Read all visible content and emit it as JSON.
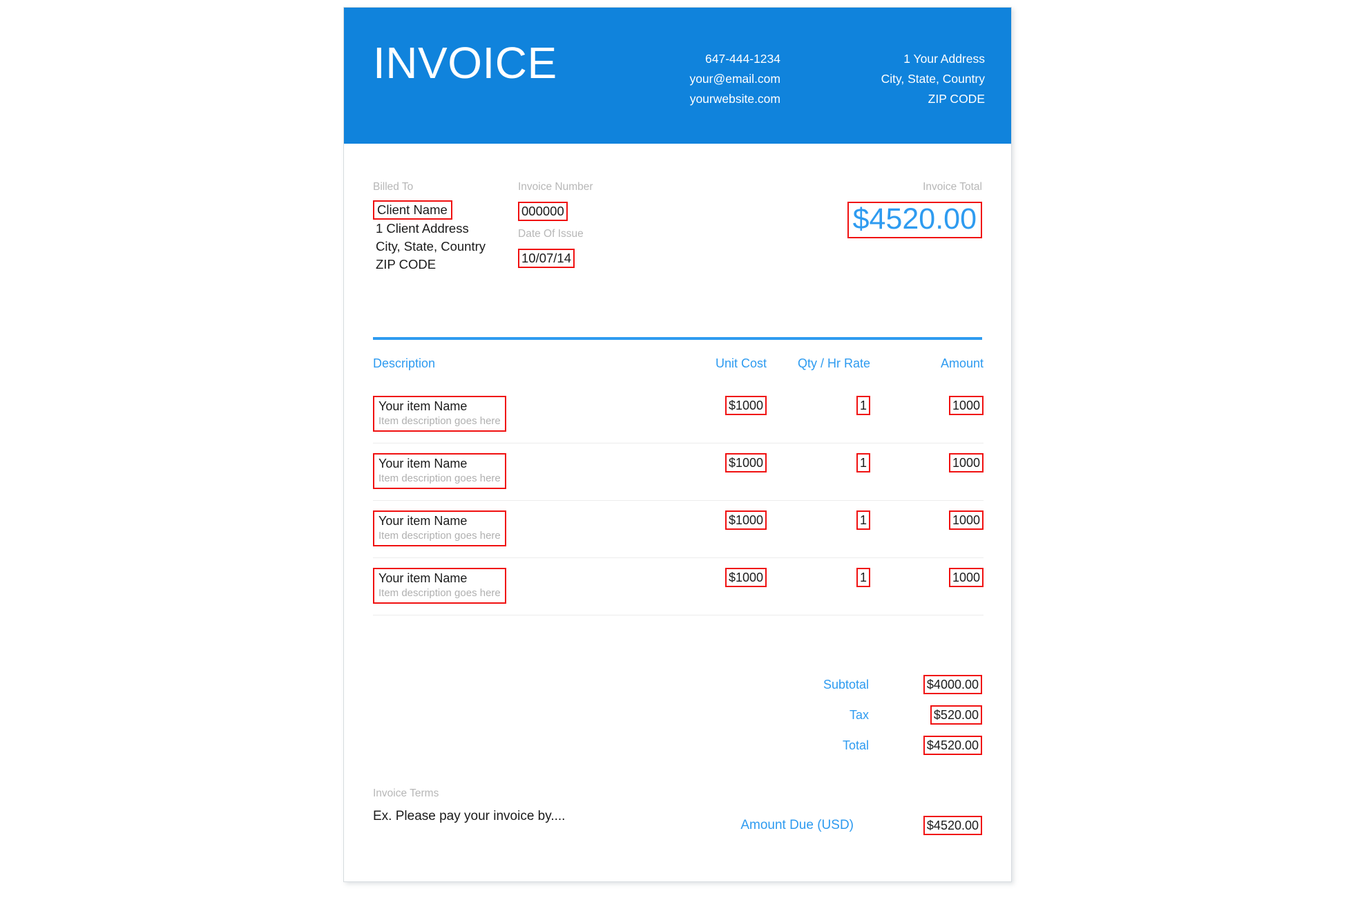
{
  "document": {
    "title": "INVOICE",
    "accent_blue": "#2e9bf0",
    "header_blue": "#1083dc",
    "annotation_red": "#f01010"
  },
  "header": {
    "title": "INVOICE",
    "contact": {
      "phone": "647-444-1234",
      "email": "your@email.com",
      "website": "yourwebsite.com"
    },
    "address": {
      "line1": "1 Your Address",
      "line2": "City, State, Country",
      "line3": "ZIP CODE"
    }
  },
  "meta": {
    "billed_to": {
      "label": "Billed To",
      "name": "Client Name",
      "address": "1 Client Address",
      "city": "City, State, Country",
      "zip": "ZIP CODE"
    },
    "invoice_number": {
      "label": "Invoice Number",
      "value": "000000"
    },
    "date_of_issue": {
      "label": "Date Of Issue",
      "value": "10/07/14"
    },
    "invoice_total": {
      "label": "Invoice Total",
      "value": "$4520.00"
    }
  },
  "table": {
    "columns": {
      "description": "Description",
      "unit_cost": "Unit Cost",
      "qty": "Qty / Hr Rate",
      "amount": "Amount"
    },
    "rows": [
      {
        "name": "Your item Name",
        "description": "Item description goes here",
        "unit_cost": "$1000",
        "qty": "1",
        "amount": "1000"
      },
      {
        "name": "Your item Name",
        "description": "Item description goes here",
        "unit_cost": "$1000",
        "qty": "1",
        "amount": "1000"
      },
      {
        "name": "Your item Name",
        "description": "Item description goes here",
        "unit_cost": "$1000",
        "qty": "1",
        "amount": "1000"
      },
      {
        "name": "Your item Name",
        "description": "Item description goes here",
        "unit_cost": "$1000",
        "qty": "1",
        "amount": "1000"
      }
    ]
  },
  "totals": {
    "subtotal_label": "Subtotal",
    "subtotal_value": "$4000.00",
    "tax_label": "Tax",
    "tax_value": "$520.00",
    "total_label": "Total",
    "total_value": "$4520.00"
  },
  "footer": {
    "terms_label": "Invoice Terms",
    "terms_text": "Ex. Please pay your invoice by....",
    "amount_due_label": "Amount Due (USD)",
    "amount_due_value": "$4520.00"
  }
}
